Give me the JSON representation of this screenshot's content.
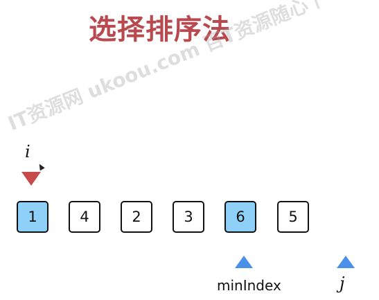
{
  "slide": {
    "title": "选择排序法"
  },
  "watermark": {
    "text": "IT资源网 ukoou.com 百T资源随心下"
  },
  "array": {
    "items": [
      {
        "value": "1",
        "highlighted": true
      },
      {
        "value": "4",
        "highlighted": false
      },
      {
        "value": "2",
        "highlighted": false
      },
      {
        "value": "3",
        "highlighted": false
      },
      {
        "value": "6",
        "highlighted": true
      },
      {
        "value": "5",
        "highlighted": false
      }
    ]
  },
  "pointers": {
    "i": {
      "label": "i",
      "color": "#c84b4b",
      "index": 0
    },
    "minIndex": {
      "label": "minIndex",
      "color": "#4a90e8",
      "index": 4
    },
    "j": {
      "label": "j",
      "color": "#4a90e8",
      "index": 6
    }
  },
  "colors": {
    "title": "#b84a4f",
    "highlight": "#8fd0f8",
    "border": "#111111"
  }
}
